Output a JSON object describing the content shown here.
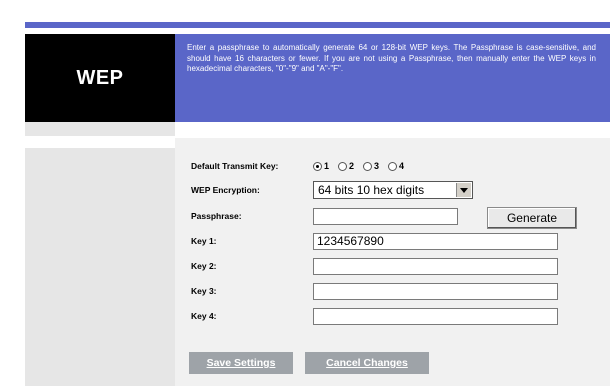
{
  "header": {
    "section_title": "WEP",
    "help_text": "Enter a passphrase to automatically generate 64 or 128-bit WEP keys. The Passphrase is case-sensitive, and should have 16 characters or fewer. If you are not using a Passphrase, then manually enter the WEP keys in hexadecimal characters, \"0\"-\"9\" and \"A\"-\"F\"."
  },
  "form": {
    "default_tx_key": {
      "label": "Default Transmit Key:",
      "options": [
        "1",
        "2",
        "3",
        "4"
      ],
      "selected": "1"
    },
    "wep_encryption": {
      "label": "WEP Encryption:",
      "value": "64 bits 10 hex digits"
    },
    "passphrase": {
      "label": "Passphrase:",
      "value": ""
    },
    "generate_label": "Generate",
    "keys": [
      {
        "label": "Key 1:",
        "value": "1234567890"
      },
      {
        "label": "Key 2:",
        "value": ""
      },
      {
        "label": "Key 3:",
        "value": ""
      },
      {
        "label": "Key 4:",
        "value": ""
      }
    ]
  },
  "actions": {
    "save_label": "Save Settings",
    "cancel_label": "Cancel Changes"
  },
  "colors": {
    "accent_blue": "#5a66c8",
    "title_bg": "#000000",
    "button_gray": "#9ea3a8"
  }
}
